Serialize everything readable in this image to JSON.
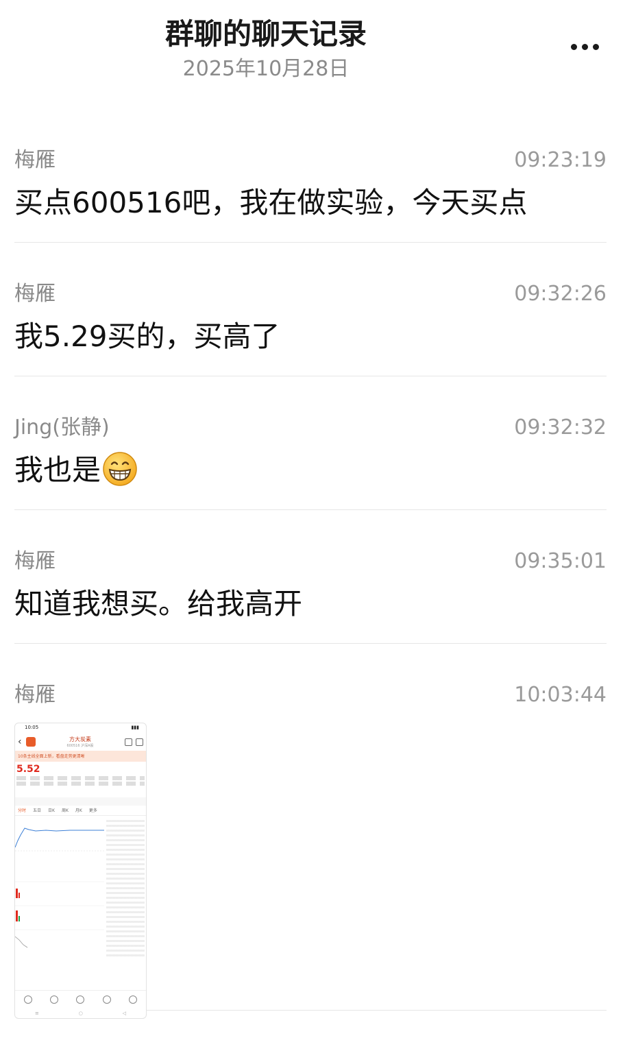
{
  "header": {
    "title": "群聊的聊天记录",
    "date": "2025年10月28日"
  },
  "messages": [
    {
      "sender": "梅雁",
      "time": "09:23:19",
      "text": "买点600516吧，我在做实验，今天买点"
    },
    {
      "sender": "梅雁",
      "time": "09:32:26",
      "text": "我5.29买的，买高了"
    },
    {
      "sender": "Jing(张静)",
      "time": "09:32:32",
      "text": "我也是",
      "emoji": "grinning-face-icon"
    },
    {
      "sender": "梅雁",
      "time": "09:35:01",
      "text": "知道我想买。给我高开"
    },
    {
      "sender": "梅雁",
      "time": "10:03:44",
      "image": {
        "status_time": "10:05",
        "app_title": "方大炭素",
        "code_line": "600516 沪深A股",
        "price": "5.52",
        "banner": "10条主线全面上新，看盘走势更清晰",
        "tabs": [
          "分时",
          "五日",
          "日K",
          "周K",
          "月K",
          "更多"
        ]
      }
    }
  ],
  "colors": {
    "stock_red": "#e02a1e",
    "app_orange": "#e85c2a"
  }
}
